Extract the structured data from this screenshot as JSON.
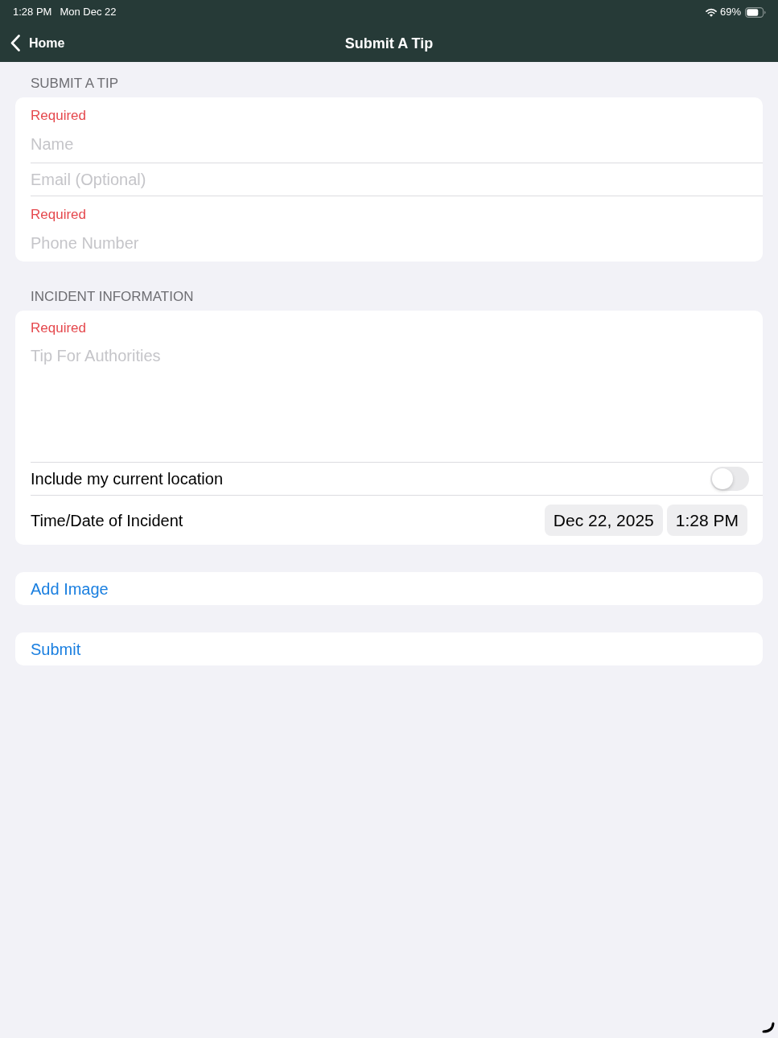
{
  "status_bar": {
    "time": "1:28 PM",
    "date": "Mon Dec 22",
    "battery_percent": "69%"
  },
  "nav_bar": {
    "back_label": "Home",
    "title": "Submit A Tip"
  },
  "sections": [
    {
      "header": "SUBMIT A TIP",
      "fields": [
        {
          "kind": "text",
          "required_label": "Required",
          "placeholder": "Name"
        },
        {
          "kind": "text",
          "placeholder": "Email (Optional)"
        },
        {
          "kind": "text",
          "required_label": "Required",
          "placeholder": "Phone Number"
        }
      ]
    },
    {
      "header": "INCIDENT INFORMATION",
      "fields": [
        {
          "kind": "textarea",
          "required_label": "Required",
          "placeholder": "Tip For Authorities"
        },
        {
          "kind": "toggle",
          "label": "Include my current location",
          "on": false
        },
        {
          "kind": "datetime",
          "label": "Time/Date of Incident",
          "date": "Dec 22, 2025",
          "time": "1:28 PM"
        }
      ]
    }
  ],
  "actions": [
    {
      "label": "Add Image"
    },
    {
      "label": "Submit"
    }
  ]
}
